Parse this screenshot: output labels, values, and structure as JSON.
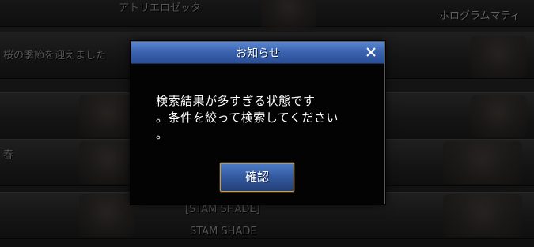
{
  "background": {
    "rows": [
      {
        "title": "アトリエロゼッタ",
        "subtitle": ""
      },
      {
        "title": "桜の季節を迎えました",
        "subtitle": ""
      },
      {
        "title": "",
        "subtitle": ""
      },
      {
        "title": "春",
        "subtitle": ""
      },
      {
        "title": "[STAM SHADE]",
        "subtitle": "STAM SHADE"
      }
    ],
    "right_header": "ホログラムマティ"
  },
  "dialog": {
    "title": "お知らせ",
    "message": "検索結果が多すぎる状態です\n。条件を絞って検索してください\n。",
    "confirm_label": "確認"
  },
  "colors": {
    "title_bar": "#3c64b0",
    "button_border": "#c9a04a",
    "dialog_bg": "#030303"
  }
}
